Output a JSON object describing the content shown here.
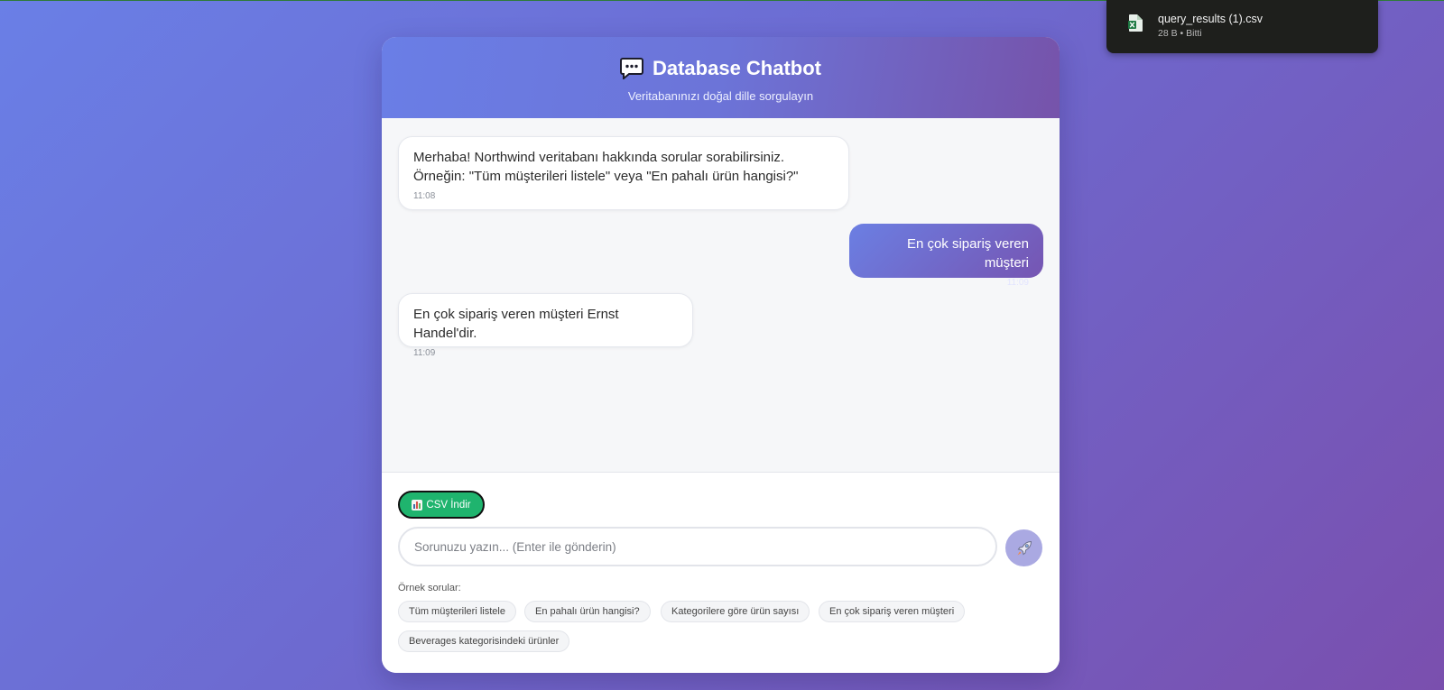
{
  "download": {
    "filename": "query_results (1).csv",
    "meta": "28 B • Bitti"
  },
  "header": {
    "title": "Database Chatbot",
    "subtitle": "Veritabanınızı doğal dille sorgulayın"
  },
  "messages": [
    {
      "role": "bot",
      "text_line1": "Merhaba! Northwind veritabanı hakkında sorular sorabilirsiniz.",
      "text_line2": "Örneğin: \"Tüm müşterileri listele\" veya \"En pahalı ürün hangisi?\"",
      "time": "11:08"
    },
    {
      "role": "user",
      "text": "En çok sipariş veren müşteri",
      "time": "11:09"
    },
    {
      "role": "bot",
      "text": "En çok sipariş veren müşteri Ernst Handel'dir.",
      "time": "11:09"
    }
  ],
  "toolbar": {
    "csv_label": "CSV İndir"
  },
  "input": {
    "placeholder": "Sorunuzu yazın... (Enter ile gönderin)",
    "value": ""
  },
  "examples": {
    "label": "Örnek sorular:",
    "items": [
      "Tüm müşterileri listele",
      "En pahalı ürün hangisi?",
      "Kategorilere göre ürün sayısı",
      "En çok sipariş veren müşteri",
      "Beverages kategorisindeki ürünler"
    ]
  },
  "colors": {
    "accent": "#667eea",
    "accent_dark": "#764ba2",
    "csv_button": "#1fb46e"
  }
}
